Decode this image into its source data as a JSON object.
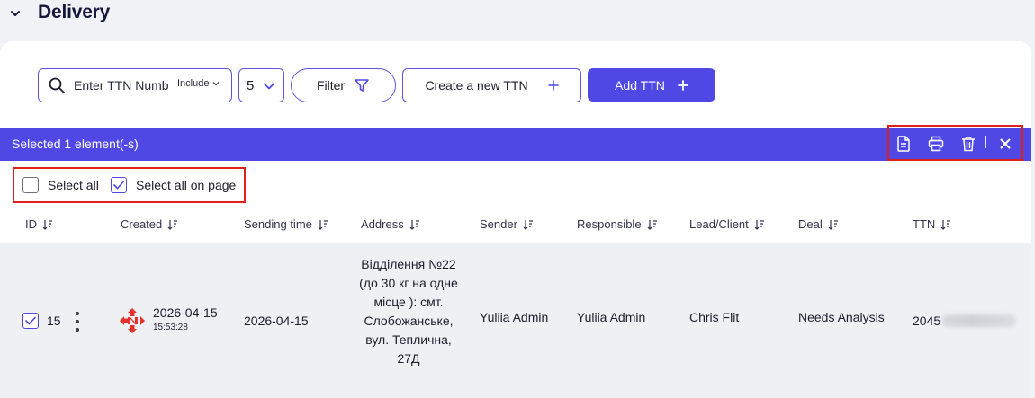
{
  "section": {
    "title": "Delivery"
  },
  "toolbar": {
    "search_placeholder": "Enter TTN Number",
    "include_label": "Include",
    "page_size": "5",
    "filter_label": "Filter",
    "create_label": "Create a new TTN",
    "add_label": "Add TTN"
  },
  "selection": {
    "text": "Selected 1 element(-s)",
    "select_all_label": "Select all",
    "select_all_on_page_label": "Select all on page",
    "select_all_checked": false,
    "select_all_on_page_checked": true
  },
  "table": {
    "columns": [
      "ID",
      "Created",
      "Sending time",
      "Address",
      "Sender",
      "Responsible",
      "Lead/Client",
      "Deal",
      "TTN"
    ],
    "rows": [
      {
        "checked": true,
        "id": "15",
        "created_date": "2026-04-15",
        "created_time": "15:53:28",
        "sending_time": "2026-04-15",
        "address": "Відділення №22 (до 30 кг на одне місце ): смт. Слобожанське, вул. Теплична, 27Д",
        "sender": "Yuliia Admin",
        "responsible": "Yuliia Admin",
        "lead_client": "Chris Flit",
        "deal": "Needs Analysis",
        "ttn": "2045"
      }
    ]
  },
  "colors": {
    "accent": "#5048e5",
    "highlight_border": "#e0201b",
    "carrier_logo": "#e5322d"
  },
  "icons": [
    "chevron-down-icon",
    "search-icon",
    "filter-icon",
    "plus-icon",
    "document-icon",
    "printer-icon",
    "trash-icon",
    "close-icon",
    "sort-icon",
    "check-icon",
    "kebab-menu-icon",
    "nova-poshta-logo"
  ]
}
